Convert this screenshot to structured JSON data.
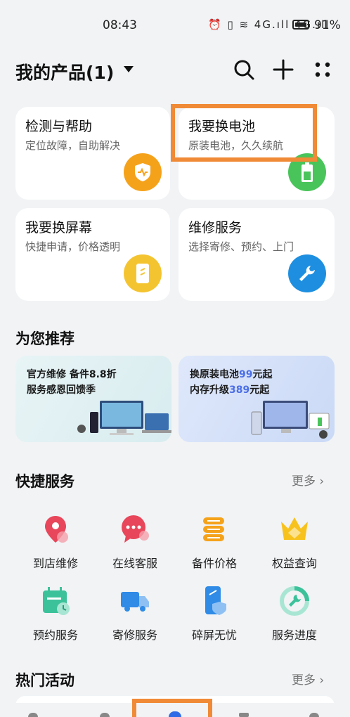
{
  "status": {
    "time": "08:43",
    "signal_text": "⏰ ▯ ≋ 4G.ıll 4G.ıll",
    "battery": "91%"
  },
  "header": {
    "title": "我的产品(1)"
  },
  "cards": [
    {
      "title": "检测与帮助",
      "subtitle": "定位故障，自助解决",
      "color": "#f5a21b"
    },
    {
      "title": "我要换电池",
      "subtitle": "原装电池，久久续航",
      "color": "#49c45a"
    },
    {
      "title": "我要换屏幕",
      "subtitle": "快捷申请，价格透明",
      "color": "#f4c430"
    },
    {
      "title": "维修服务",
      "subtitle": "选择寄修、预约、上门",
      "color": "#1e8fe0"
    }
  ],
  "recommend": {
    "title": "为您推荐",
    "promo1": {
      "line1": "官方维修 备件8.8折",
      "line2": "服务感恩回馈季"
    },
    "promo2": {
      "line1a": "换原装电池",
      "line1b": "99",
      "line1c": "元起",
      "line2a": "内存升级",
      "line2b": "389",
      "line2c": "元起"
    }
  },
  "quick": {
    "title": "快捷服务",
    "more": "更多",
    "items": [
      {
        "label": "到店维修",
        "icon": "location-pin-icon"
      },
      {
        "label": "在线客服",
        "icon": "chat-bubble-icon"
      },
      {
        "label": "备件价格",
        "icon": "coin-stack-icon"
      },
      {
        "label": "权益查询",
        "icon": "crown-icon"
      },
      {
        "label": "预约服务",
        "icon": "calendar-clock-icon"
      },
      {
        "label": "寄修服务",
        "icon": "delivery-truck-icon"
      },
      {
        "label": "碎屏无忧",
        "icon": "phone-shield-icon"
      },
      {
        "label": "服务进度",
        "icon": "wrench-progress-icon"
      }
    ]
  },
  "hot": {
    "title": "热门活动",
    "more": "更多"
  }
}
